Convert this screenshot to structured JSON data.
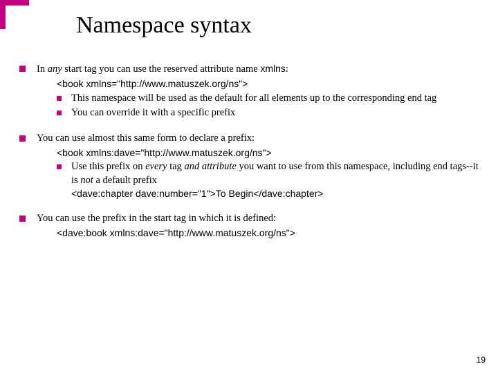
{
  "title": "Namespace syntax",
  "bullets": {
    "b1": {
      "pre": "In ",
      "em": "any",
      "post": " start tag you can use the reserved attribute name ",
      "code": "xmlns",
      "tail": ":"
    },
    "b1code": "<book xmlns=\"http://www.matuszek.org/ns\">",
    "b1a": "This namespace will be used as the default for all elements up to the corresponding end tag",
    "b1b": "You can override it with a specific prefix",
    "b2": "You can use almost this same form to declare a prefix:",
    "b2code": "<book xmlns:dave=\"http://www.matuszek.org/ns\">",
    "b2a": {
      "pre": "Use this prefix on ",
      "em1": "every",
      "mid1": " tag ",
      "em2": "and attribute",
      "mid2": " you want to use from this namespace, including end tags--it is ",
      "em3": "not",
      "post": " a default prefix"
    },
    "b2acode": "<dave:chapter dave:number=\"1\">To Begin</dave:chapter>",
    "b3": "You can use the prefix in the start tag in which it is defined:",
    "b3code": "<dave:book xmlns:dave=\"http://www.matuszek.org/ns\">"
  },
  "pageNumber": "19"
}
